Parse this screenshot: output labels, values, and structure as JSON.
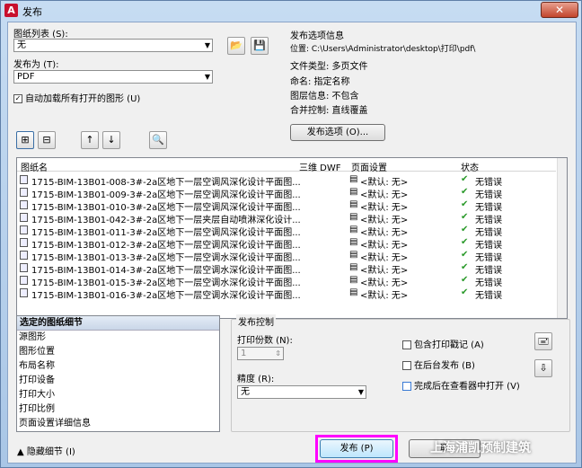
{
  "window": {
    "title": "发布",
    "app_icon": "A",
    "close_glyph": "✕"
  },
  "sheet_list": {
    "label": "图纸列表 (S):",
    "value": "无"
  },
  "publish_to": {
    "label": "发布为 (T):",
    "value": "PDF"
  },
  "auto_load": {
    "label": "自动加载所有打开的图形 (U)",
    "checked": true
  },
  "info": {
    "title": "发布选项信息",
    "location": "位置: C:\\Users\\Administrator\\desktop\\打印\\pdf\\",
    "file_type": "文件类型: 多页文件",
    "naming": "命名: 指定名称",
    "layer": "图层信息: 不包含",
    "merge": "合并控制: 直线覆盖",
    "options_button": "发布选项 (O)..."
  },
  "list": {
    "headers": {
      "name": "图纸名",
      "dwf": "三维 DWF",
      "page_setup": "页面设置",
      "status": "状态"
    },
    "rows": [
      {
        "name": "1715-BIM-13B01-008-3#-2a区地下一层空调风深化设计平面图...",
        "setup": "<默认: 无>",
        "status": "无错误"
      },
      {
        "name": "1715-BIM-13B01-009-3#-2a区地下一层空调风深化设计平面图...",
        "setup": "<默认: 无>",
        "status": "无错误"
      },
      {
        "name": "1715-BIM-13B01-010-3#-2a区地下一层空调风深化设计平面图...",
        "setup": "<默认: 无>",
        "status": "无错误"
      },
      {
        "name": "1715-BIM-13B01-042-3#-2a区地下一层夹层自动喷淋深化设计...",
        "setup": "<默认: 无>",
        "status": "无错误"
      },
      {
        "name": "1715-BIM-13B01-011-3#-2a区地下一层空调风深化设计平面图...",
        "setup": "<默认: 无>",
        "status": "无错误"
      },
      {
        "name": "1715-BIM-13B01-012-3#-2a区地下一层空调风深化设计平面图...",
        "setup": "<默认: 无>",
        "status": "无错误"
      },
      {
        "name": "1715-BIM-13B01-013-3#-2a区地下一层空调水深化设计平面图...",
        "setup": "<默认: 无>",
        "status": "无错误"
      },
      {
        "name": "1715-BIM-13B01-014-3#-2a区地下一层空调水深化设计平面图...",
        "setup": "<默认: 无>",
        "status": "无错误"
      },
      {
        "name": "1715-BIM-13B01-015-3#-2a区地下一层空调水深化设计平面图...",
        "setup": "<默认: 无>",
        "status": "无错误"
      },
      {
        "name": "1715-BIM-13B01-016-3#-2a区地下一层空调水深化设计平面图...",
        "setup": "<默认: 无>",
        "status": "无错误"
      }
    ]
  },
  "detail": {
    "title": "选定的图纸细节",
    "items": [
      "源图形",
      "图形位置",
      "布局名称",
      "打印设备",
      "打印大小",
      "打印比例",
      "页面设置详细信息"
    ]
  },
  "publish_control": {
    "title": "发布控制",
    "copies_label": "打印份数 (N):",
    "copies": "1",
    "precision_label": "精度 (R):",
    "precision": "无",
    "include_stamp": "包含打印戳记 (A)",
    "background": "在后台发布 (B)",
    "open_viewer": "完成后在查看器中打开 (V)"
  },
  "footer": {
    "hide_details": "▲ 隐藏细节 (I)",
    "publish": "发布 (P)",
    "cancel": "取"
  },
  "watermark": "上海浦凯预制建筑"
}
